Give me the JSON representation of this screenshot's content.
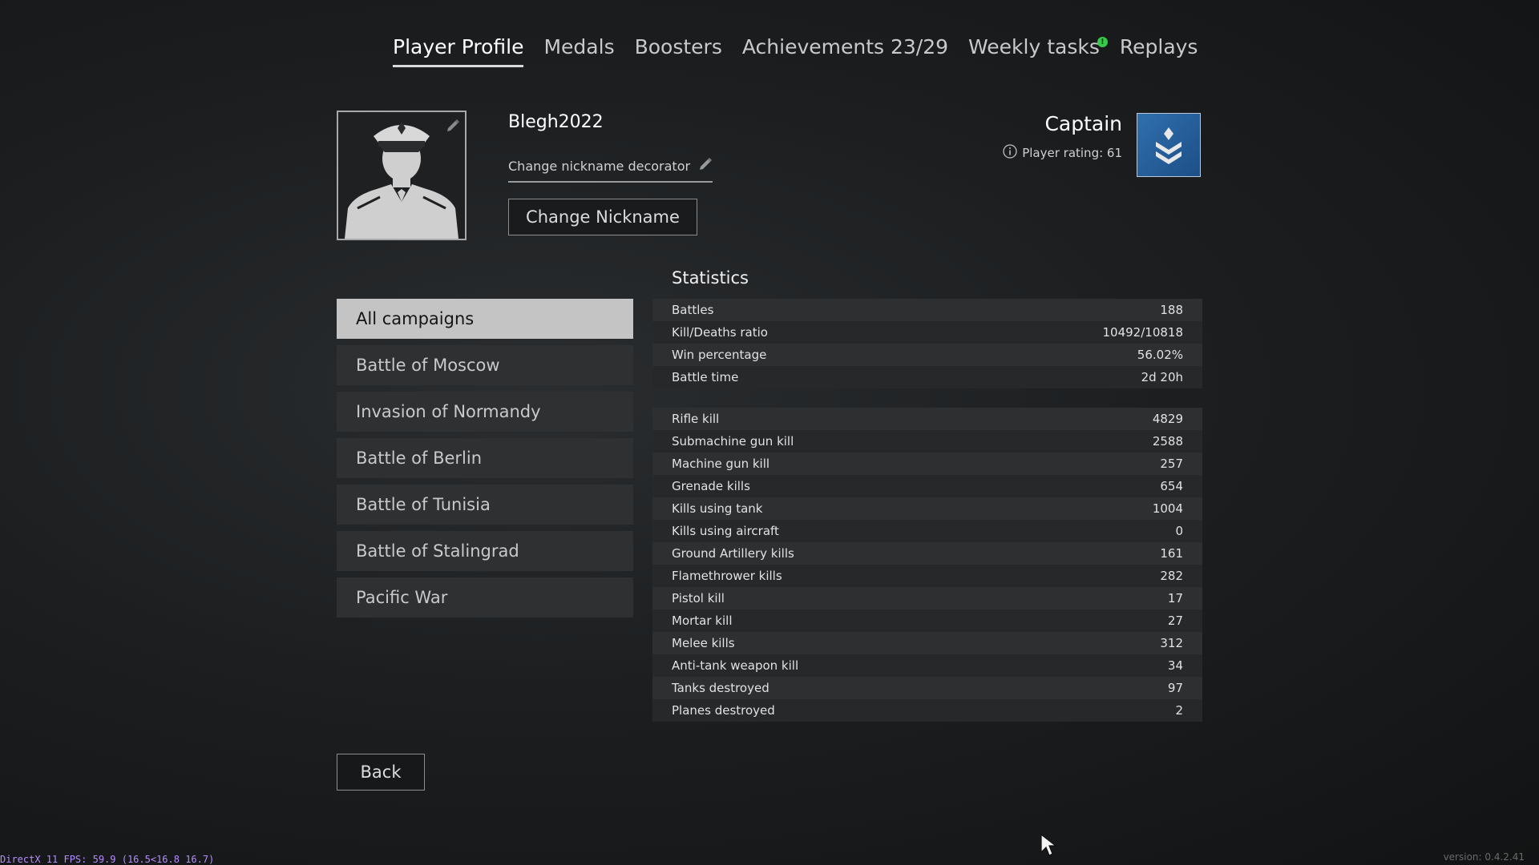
{
  "tabs": [
    {
      "label": "Player Profile"
    },
    {
      "label": "Medals"
    },
    {
      "label": "Boosters"
    },
    {
      "label": "Achievements 23/29"
    },
    {
      "label": "Weekly tasks",
      "badge": "!"
    },
    {
      "label": "Replays"
    }
  ],
  "profile": {
    "nickname": "Blegh2022",
    "decorator_label": "Change nickname decorator",
    "change_nickname_label": "Change Nickname",
    "rank": "Captain",
    "player_rating": "Player rating: 61",
    "rank_badge_color": "#2a62a0"
  },
  "campaigns": [
    {
      "label": "All campaigns"
    },
    {
      "label": "Battle of Moscow"
    },
    {
      "label": "Invasion of Normandy"
    },
    {
      "label": "Battle of Berlin"
    },
    {
      "label": "Battle of Tunisia"
    },
    {
      "label": "Battle of Stalingrad"
    },
    {
      "label": "Pacific War"
    }
  ],
  "statistics": {
    "title": "Statistics",
    "summary": [
      {
        "label": "Battles",
        "value": "188"
      },
      {
        "label": "Kill/Deaths ratio",
        "value": "10492/10818"
      },
      {
        "label": "Win percentage",
        "value": "56.02%"
      },
      {
        "label": "Battle time",
        "value": "2d 20h"
      }
    ],
    "kills": [
      {
        "label": "Rifle kill",
        "value": "4829"
      },
      {
        "label": "Submachine gun kill",
        "value": "2588"
      },
      {
        "label": "Machine gun kill",
        "value": "257"
      },
      {
        "label": "Grenade kills",
        "value": "654"
      },
      {
        "label": "Kills using tank",
        "value": "1004"
      },
      {
        "label": "Kills using aircraft",
        "value": "0"
      },
      {
        "label": "Ground Artillery kills",
        "value": "161"
      },
      {
        "label": "Flamethrower kills",
        "value": "282"
      },
      {
        "label": "Pistol kill",
        "value": "17"
      },
      {
        "label": "Mortar kill",
        "value": "27"
      },
      {
        "label": "Melee kills",
        "value": "312"
      },
      {
        "label": "Anti-tank weapon kill",
        "value": "34"
      },
      {
        "label": "Tanks destroyed",
        "value": "97"
      },
      {
        "label": "Planes destroyed",
        "value": "2"
      }
    ]
  },
  "back_label": "Back",
  "fps_overlay": "DirectX 11 FPS: 59.9 (16.5<16.8 16.7)",
  "version": "version: 0.4.2.41",
  "icons": {
    "avatar": "officer-silhouette-icon",
    "edit": "pencil-icon",
    "info": "info-icon",
    "rank": "captain-chevron-icon",
    "cursor": "mouse-cursor-icon"
  }
}
